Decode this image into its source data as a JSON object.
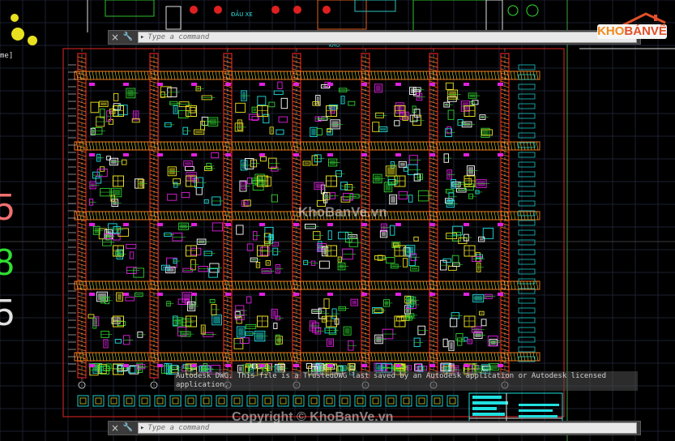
{
  "command_bar_top": {
    "prompt": "▸",
    "placeholder": "Type a command",
    "close_icon": "×",
    "wrench_icon": "🔧"
  },
  "command_bar_bottom": {
    "prompt": "▸",
    "placeholder": "Type a command",
    "close_icon": "×",
    "wrench_icon": "🔧"
  },
  "warning_text": "Autodesk DWG.  This file is a TrustedDWG last saved by an Autodesk application or Autodesk licensed application.",
  "top_labels": {
    "dau_xe": "ĐẦU XE",
    "kho_1": "KHO",
    "kho_2": "KHO"
  },
  "side_label": "me]",
  "left_numbers": [
    "5",
    "8",
    "5"
  ],
  "logo": {
    "k": "KHO",
    "b": "BÁNVẼ"
  },
  "watermark_center": "KhoBanVe.vn",
  "watermark_bottom": "Copyright © KhoBanVe.vn",
  "colors": {
    "red": "#e02020",
    "orange": "#f07020",
    "green": "#30d030",
    "cyan": "#20e0e0",
    "magenta": "#e020e0",
    "yellow": "#e8e020",
    "bg": "#000000"
  }
}
